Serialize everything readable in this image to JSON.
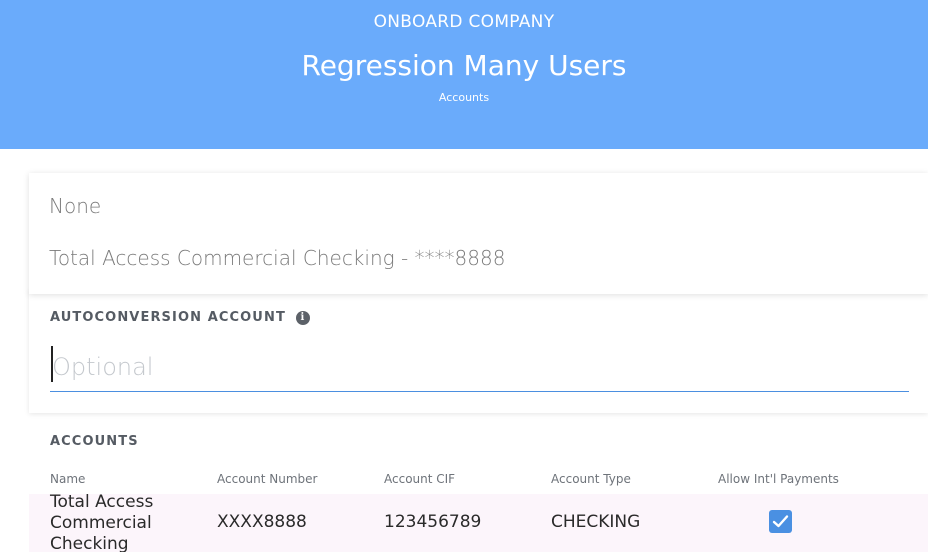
{
  "header": {
    "kicker": "ONBOARD COMPANY",
    "title": "Regression Many Users",
    "subtitle": "Accounts"
  },
  "dropdown": {
    "options": [
      "None",
      "Total Access Commercial Checking - ****8888"
    ]
  },
  "autoconversion": {
    "label": "AUTOCONVERSION ACCOUNT",
    "value": "",
    "placeholder": "Optional",
    "info_icon": "info-icon"
  },
  "accounts": {
    "title": "ACCOUNTS",
    "columns": [
      "Name",
      "Account Number",
      "Account CIF",
      "Account Type",
      "Allow Int'l Payments"
    ],
    "rows": [
      {
        "name": "Total Access Commercial Checking",
        "account_number": "XXXX8888",
        "cif": "123456789",
        "type": "CHECKING",
        "allow_intl": true
      }
    ]
  },
  "colors": {
    "header_bg": "#6aabfb",
    "accent": "#4a90e2",
    "row_bg": "#fcf5fb"
  }
}
